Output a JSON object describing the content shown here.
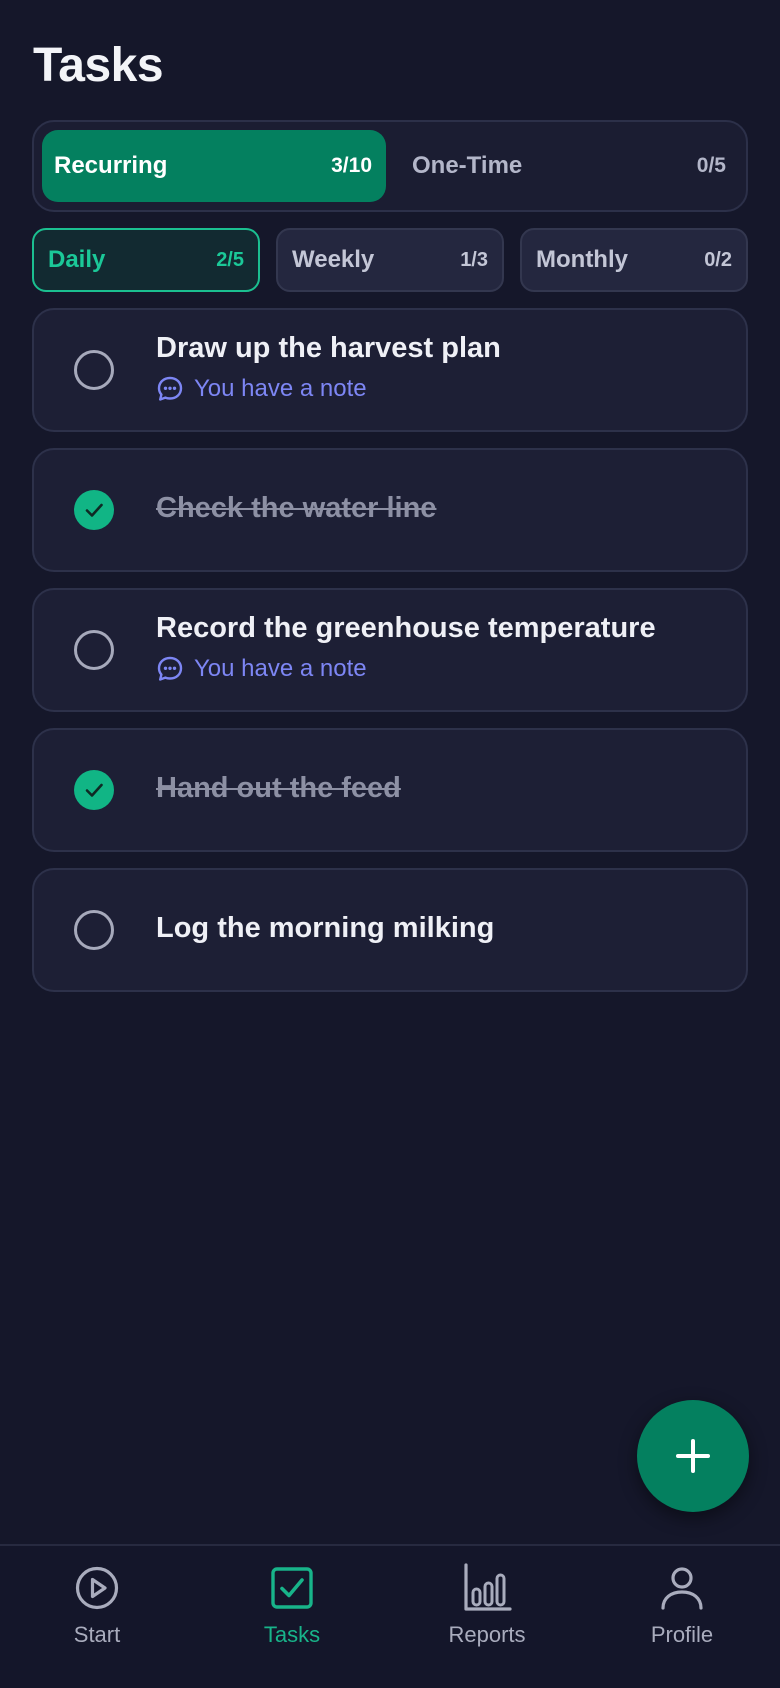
{
  "page": {
    "title": "Tasks"
  },
  "segment": {
    "tabs": [
      {
        "label": "Recurring",
        "count": "3/10",
        "active": true
      },
      {
        "label": "One-Time",
        "count": "0/5",
        "active": false
      }
    ]
  },
  "periods": [
    {
      "label": "Daily",
      "count": "2/5",
      "active": true
    },
    {
      "label": "Weekly",
      "count": "1/3",
      "active": false
    },
    {
      "label": "Monthly",
      "count": "0/2",
      "active": false
    }
  ],
  "tasks": [
    {
      "title": "Draw up the harvest plan",
      "done": false,
      "note": "You have a note"
    },
    {
      "title": "Check the water line",
      "done": true,
      "note": ""
    },
    {
      "title": "Record the greenhouse temperature",
      "done": false,
      "note": "You have a note"
    },
    {
      "title": "Hand out the feed",
      "done": true,
      "note": ""
    },
    {
      "title": "Log the morning milking",
      "done": false,
      "note": ""
    }
  ],
  "fab": {
    "icon": "plus-icon"
  },
  "nav": {
    "items": [
      {
        "label": "Start",
        "icon": "play-circle-icon",
        "active": false
      },
      {
        "label": "Tasks",
        "icon": "checkbox-icon",
        "active": true
      },
      {
        "label": "Reports",
        "icon": "bar-chart-icon",
        "active": false
      },
      {
        "label": "Profile",
        "icon": "person-icon",
        "active": false
      }
    ]
  },
  "colors": {
    "background": "#15172a",
    "accent": "#04805f",
    "accent_bright": "#11b585",
    "note": "#7d86f4",
    "card": "#1d1f35"
  }
}
